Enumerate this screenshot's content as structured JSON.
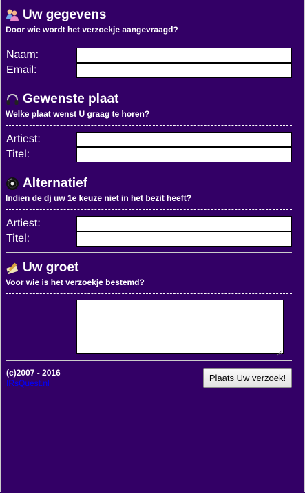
{
  "sections": [
    {
      "title": "Uw gegevens",
      "subtitle": "Door wie wordt het verzoekje aangevraagd?",
      "icon": "users-icon",
      "fields": [
        {
          "label": "Naam:",
          "value": ""
        },
        {
          "label": "Email:",
          "value": ""
        }
      ]
    },
    {
      "title": "Gewenste plaat",
      "subtitle": "Welke plaat wenst U graag te horen?",
      "icon": "headphones-icon",
      "fields": [
        {
          "label": "Artiest:",
          "value": ""
        },
        {
          "label": "Titel:",
          "value": ""
        }
      ]
    },
    {
      "title": "Alternatief",
      "subtitle": "Indien de dj uw 1e keuze niet in het bezit heeft?",
      "icon": "vinyl-record-icon",
      "fields": [
        {
          "label": "Artiest:",
          "value": ""
        },
        {
          "label": "Titel:",
          "value": ""
        }
      ]
    },
    {
      "title": "Uw groet",
      "subtitle": "Voor wie is het verzoekje bestemd?",
      "icon": "notepad-pencil-icon",
      "message": ""
    }
  ],
  "footer": {
    "copyright": "(c)2007 - 2016",
    "site_link": "IRsQuest.nl",
    "submit_label": "Plaats Uw verzoek!"
  },
  "colors": {
    "background": "#330066",
    "text": "#ffffff",
    "link": "#0000ff"
  }
}
